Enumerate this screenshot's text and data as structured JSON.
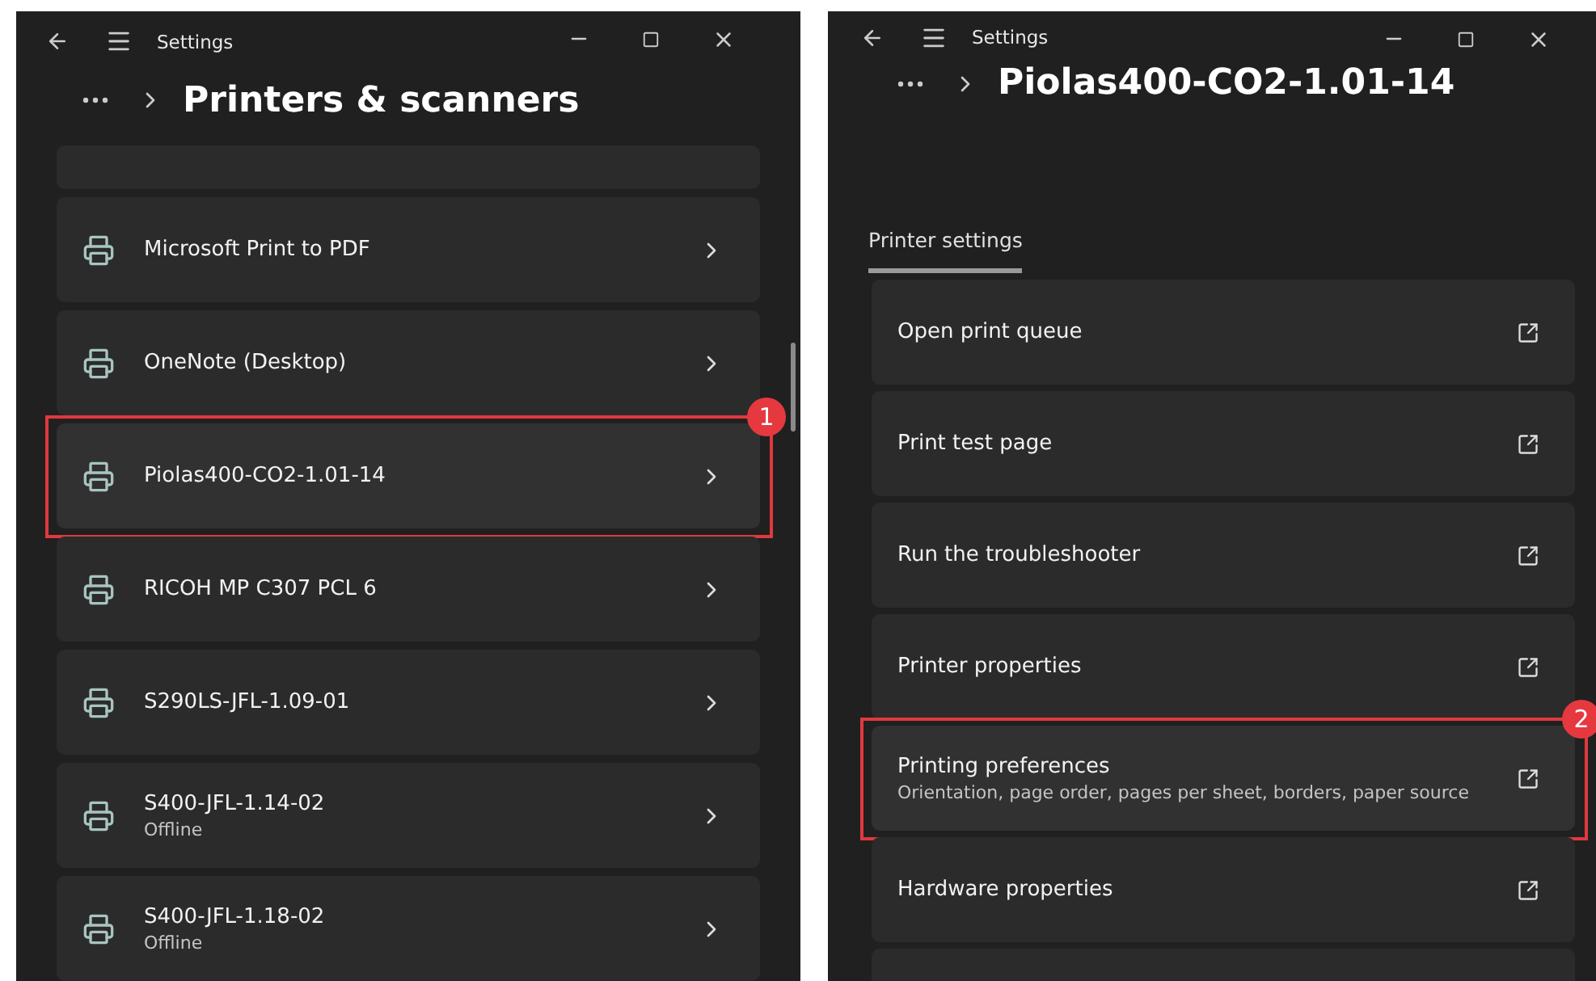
{
  "printers_window": {
    "app_title": "Settings",
    "heading": "Printers & scanners",
    "printers": [
      {
        "name": "Microsoft Print to PDF",
        "highlighted": false
      },
      {
        "name": "OneNote (Desktop)",
        "highlighted": false
      },
      {
        "name": "Piolas400-CO2-1.01-14",
        "highlighted": true,
        "badge": "1"
      },
      {
        "name": "RICOH MP C307 PCL 6",
        "highlighted": false
      },
      {
        "name": "S290LS-JFL-1.09-01",
        "highlighted": false
      },
      {
        "name": "S400-JFL-1.14-02",
        "status": "Offline",
        "highlighted": false
      },
      {
        "name": "S400-JFL-1.18-02",
        "status": "Offline",
        "highlighted": false
      }
    ]
  },
  "printer_window": {
    "app_title": "Settings",
    "heading": "Piolas400-CO2-1.01-14",
    "tabs": [
      {
        "label": "Printer settings",
        "selected": true
      }
    ],
    "settings": [
      {
        "label": "Open print queue",
        "highlighted": false
      },
      {
        "label": "Print test page",
        "highlighted": false
      },
      {
        "label": "Run the troubleshooter",
        "highlighted": false
      },
      {
        "label": "Printer properties",
        "highlighted": false
      },
      {
        "label": "Printing preferences",
        "description": "Orientation, page order, pages per sheet, borders, paper source",
        "highlighted": true,
        "badge": "2"
      },
      {
        "label": "Hardware properties",
        "highlighted": false
      }
    ]
  }
}
